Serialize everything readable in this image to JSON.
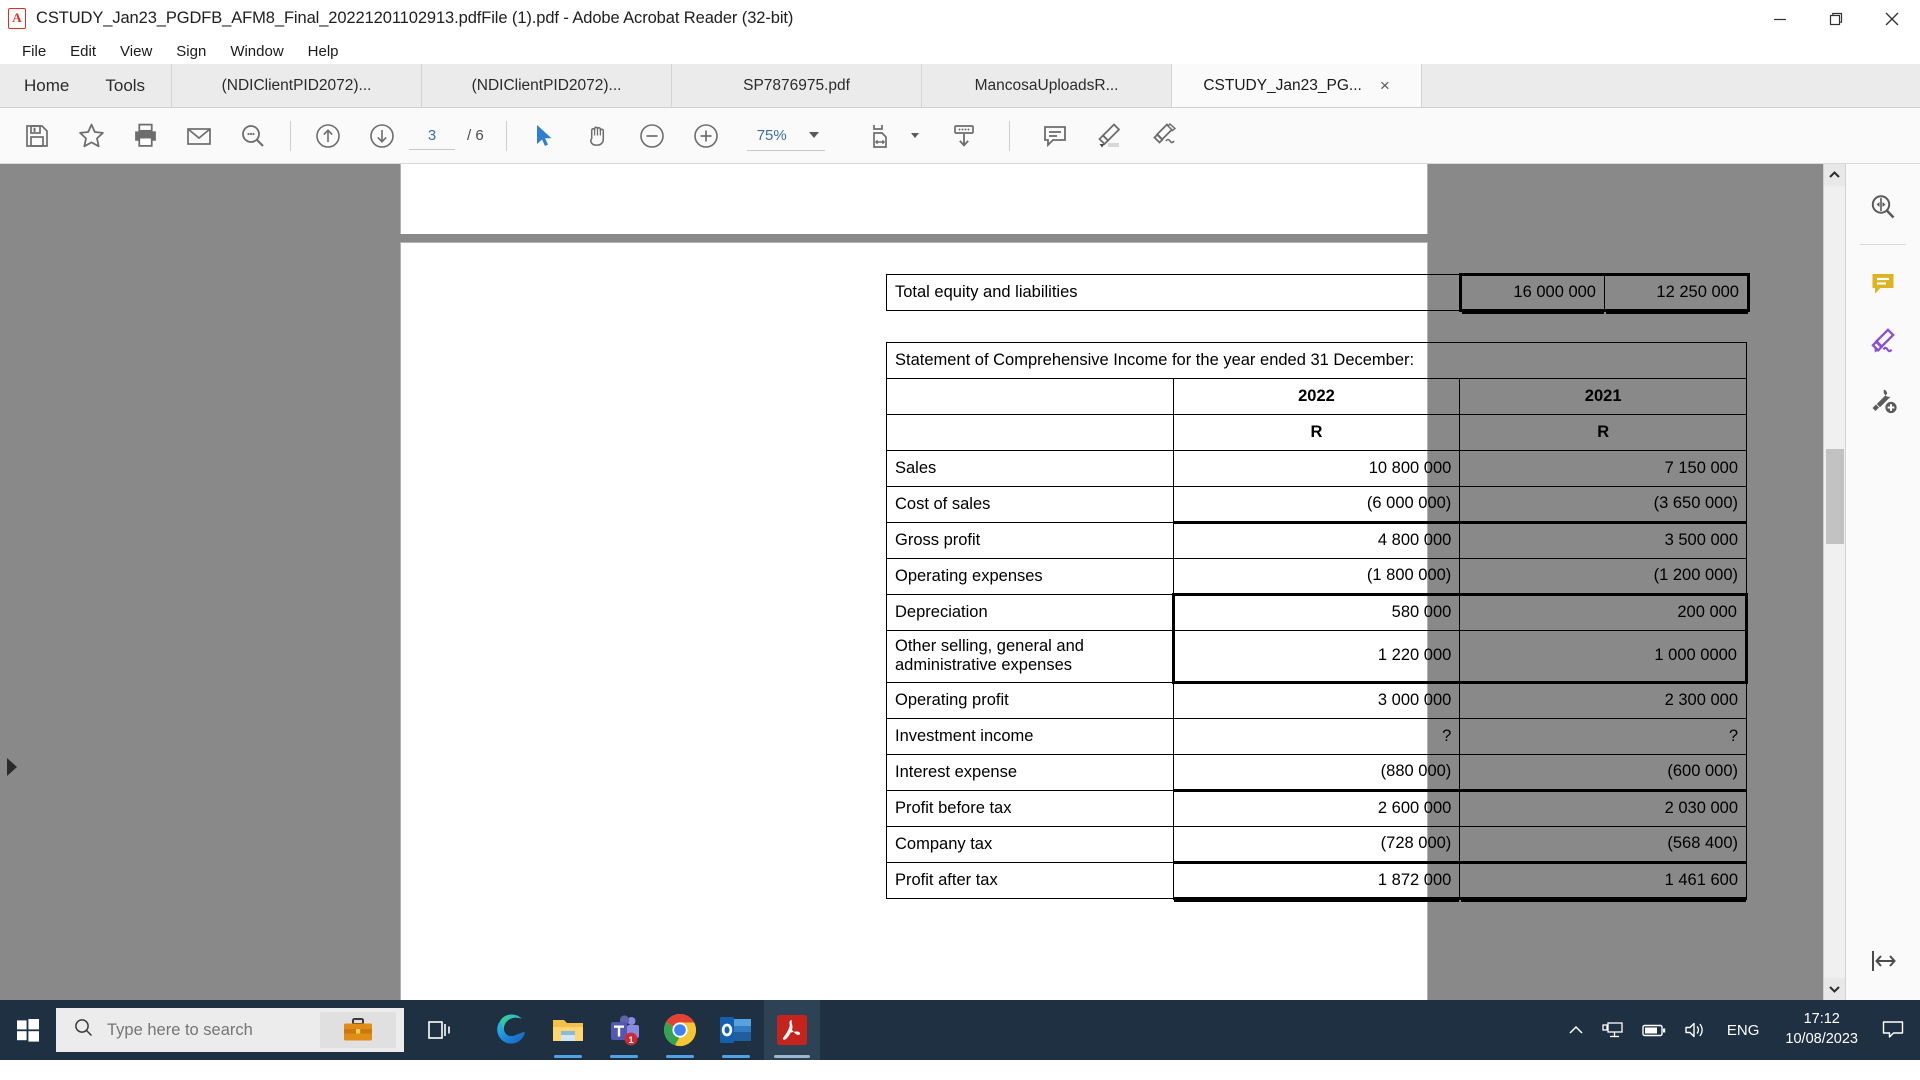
{
  "window": {
    "title": "CSTUDY_Jan23_PGDFB_AFM8_Final_20221201102913.pdfFile (1).pdf - Adobe Acrobat Reader (32-bit)",
    "app_icon": "acrobat-icon",
    "minimize": "minimize-icon",
    "restore": "restore-icon",
    "close": "close-icon"
  },
  "menu": {
    "items": [
      {
        "label": "File"
      },
      {
        "label": "Edit"
      },
      {
        "label": "View"
      },
      {
        "label": "Sign"
      },
      {
        "label": "Window"
      },
      {
        "label": "Help"
      }
    ]
  },
  "tabs": {
    "home": "Home",
    "tools": "Tools",
    "documents": [
      {
        "label": "(NDIClientPID2072)...",
        "active": false
      },
      {
        "label": "(NDIClientPID2072)...",
        "active": false
      },
      {
        "label": "SP7876975.pdf",
        "active": false
      },
      {
        "label": "MancosaUploadsR...",
        "active": false
      },
      {
        "label": "CSTUDY_Jan23_PG...",
        "active": true,
        "close": "×"
      }
    ]
  },
  "toolbar": {
    "save": "save-icon",
    "star": "add-to-favorites-icon",
    "print": "print-icon",
    "email": "email-icon",
    "search": "search-icon",
    "prev_page": "previous-page-icon",
    "next_page": "next-page-icon",
    "page_current": "3",
    "page_total": "/ 6",
    "select_tool": "select-cursor-icon",
    "hand_tool": "hand-tool-icon",
    "zoom_out": "zoom-out-icon",
    "zoom_in": "zoom-in-icon",
    "zoom_level": "75%",
    "zoom_dropdown": "chevron-down-icon",
    "fit_page": "fit-page-icon",
    "fit_dropdown": "chevron-down-icon",
    "scroll_mode": "page-display-icon",
    "comment": "add-comment-icon",
    "highlight": "highlight-text-icon",
    "sign": "fill-and-sign-icon"
  },
  "right_panel": {
    "items": [
      {
        "name": "search-compare-icon",
        "color": "#5a5a5a"
      },
      {
        "name": "comment-icon",
        "color": "#d9b020"
      },
      {
        "name": "fill-and-sign-icon",
        "color": "#8a4fd1"
      },
      {
        "name": "more-tools-icon",
        "color": "#5a5a5a"
      }
    ],
    "collapse": "collapse-panel-icon"
  },
  "scrollbar": {
    "up_arrow": "scroll-up-icon",
    "down_arrow": "scroll-down-icon"
  },
  "document": {
    "table_top": {
      "rows": [
        {
          "label": "Total equity and liabilities",
          "v2022": "16 000 000",
          "v2021": "12 250 000",
          "bold": true
        }
      ]
    },
    "table_main": {
      "heading": "Statement of Comprehensive Income for the year ended 31 December:",
      "col_years": {
        "label": "",
        "v2022": "2022",
        "v2021": "2021"
      },
      "col_units": {
        "label": "",
        "v2022": "R",
        "v2021": "R"
      },
      "rows": [
        {
          "label": "Sales",
          "v2022": "10 800 000",
          "v2021": "7 150 000"
        },
        {
          "label": "Cost of sales",
          "v2022": "(6 000 000)",
          "v2021": "(3 650 000)"
        },
        {
          "label": "Gross profit",
          "v2022": "4 800 000",
          "v2021": "3 500 000"
        },
        {
          "label": "Operating expenses",
          "v2022": "(1 800 000)",
          "v2021": "(1 200 000)"
        },
        {
          "label": "Depreciation",
          "v2022": "580 000",
          "v2021": "200 000"
        },
        {
          "label": "Other selling, general and administrative expenses",
          "v2022": "1 220 000",
          "v2021": "1 000 0000"
        },
        {
          "label": "Operating profit",
          "v2022": "3 000 000",
          "v2021": "2 300 000"
        },
        {
          "label": "Investment income",
          "v2022": "?",
          "v2021": "?"
        },
        {
          "label": "Interest expense",
          "v2022": "(880 000)",
          "v2021": "(600 000)"
        },
        {
          "label": "Profit before tax",
          "v2022": "2 600 000",
          "v2021": "2 030 000"
        },
        {
          "label": "Company tax",
          "v2022": "(728 000)",
          "v2021": "(568 400)"
        },
        {
          "label": "Profit after tax",
          "v2022": "1 872 000",
          "v2021": "1 461 600"
        }
      ]
    }
  },
  "taskbar": {
    "start": "windows-start-icon",
    "search_placeholder": "Type here to search",
    "search_value": "",
    "search_icon": "search-icon",
    "briefcase_icon": "briefcase-icon",
    "task_view": "task-view-icon",
    "apps": [
      {
        "name": "edge-icon",
        "label": "Microsoft Edge",
        "running": false,
        "active": false
      },
      {
        "name": "file-explorer-icon",
        "label": "File Explorer",
        "running": true,
        "active": false
      },
      {
        "name": "teams-icon",
        "label": "Microsoft Teams",
        "running": true,
        "active": false,
        "badge": "1"
      },
      {
        "name": "chrome-icon",
        "label": "Google Chrome",
        "running": true,
        "active": false
      },
      {
        "name": "outlook-icon",
        "label": "Microsoft Outlook",
        "running": true,
        "active": false
      },
      {
        "name": "acrobat-icon",
        "label": "Adobe Acrobat Reader",
        "running": true,
        "active": true
      }
    ],
    "tray": {
      "overflow": "show-hidden-icons-icon",
      "network": "network-icon",
      "battery": "battery-icon",
      "volume": "volume-icon",
      "language": "ENG",
      "time": "17:12",
      "date": "10/08/2023",
      "notifications": "notification-center-icon"
    }
  }
}
